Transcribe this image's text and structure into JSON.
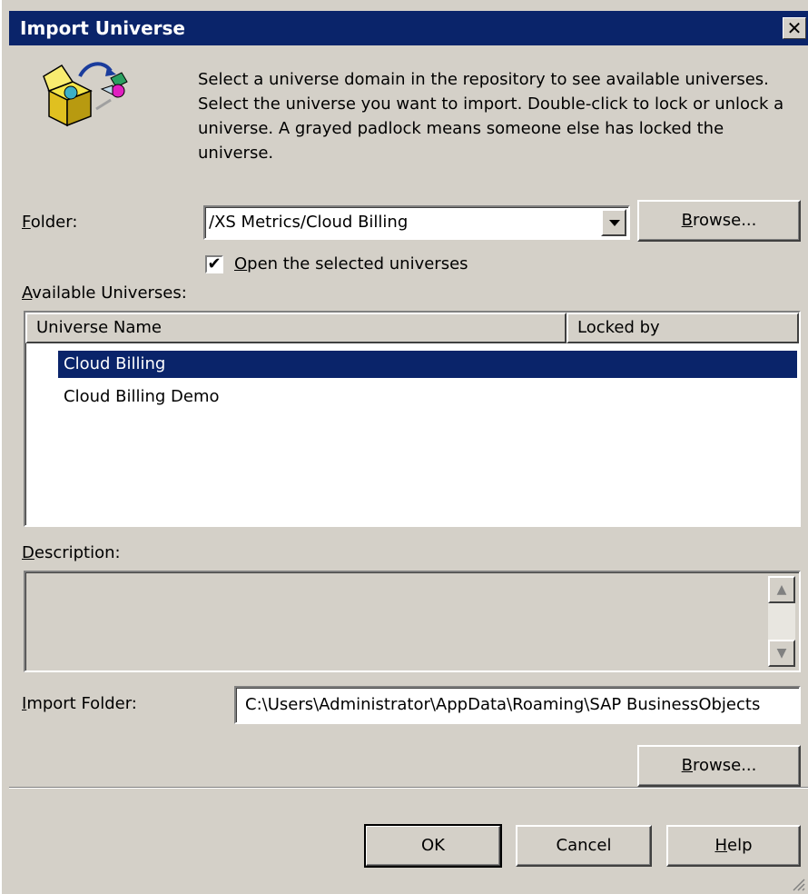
{
  "dialog": {
    "title": "Import Universe",
    "close_glyph": "✕",
    "instructions": "Select a universe domain in the repository to see available universes. Select the universe you want to import. Double-click to lock or unlock a universe. A grayed padlock means someone else has locked the universe."
  },
  "folder": {
    "label_accel": "F",
    "label_rest": "older:",
    "value": "/XS Metrics/Cloud Billing",
    "browse_accel": "B",
    "browse_rest": "rowse..."
  },
  "open_checkbox": {
    "checked": true,
    "check_glyph": "✔",
    "label_accel": "O",
    "label_rest": "pen the selected universes"
  },
  "available": {
    "label_accel": "A",
    "label_rest": "vailable Universes:",
    "columns": [
      "Universe Name",
      "Locked by"
    ],
    "rows": [
      {
        "name": "Cloud Billing",
        "locked_by": "",
        "selected": true
      },
      {
        "name": "Cloud Billing Demo",
        "locked_by": "",
        "selected": false
      }
    ]
  },
  "description": {
    "label_accel": "D",
    "label_rest": "escription:",
    "value": ""
  },
  "import_folder": {
    "label_accel": "I",
    "label_rest": "mport Folder:",
    "value": "C:\\Users\\Administrator\\AppData\\Roaming\\SAP BusinessObjects",
    "browse_accel": "B",
    "browse_rest": "rowse..."
  },
  "buttons": {
    "ok": "OK",
    "cancel": "Cancel",
    "help_accel": "H",
    "help_rest": "elp"
  },
  "colors": {
    "titlebar": "#0a246a",
    "face": "#d4d0c8",
    "selection": "#0a246a"
  }
}
